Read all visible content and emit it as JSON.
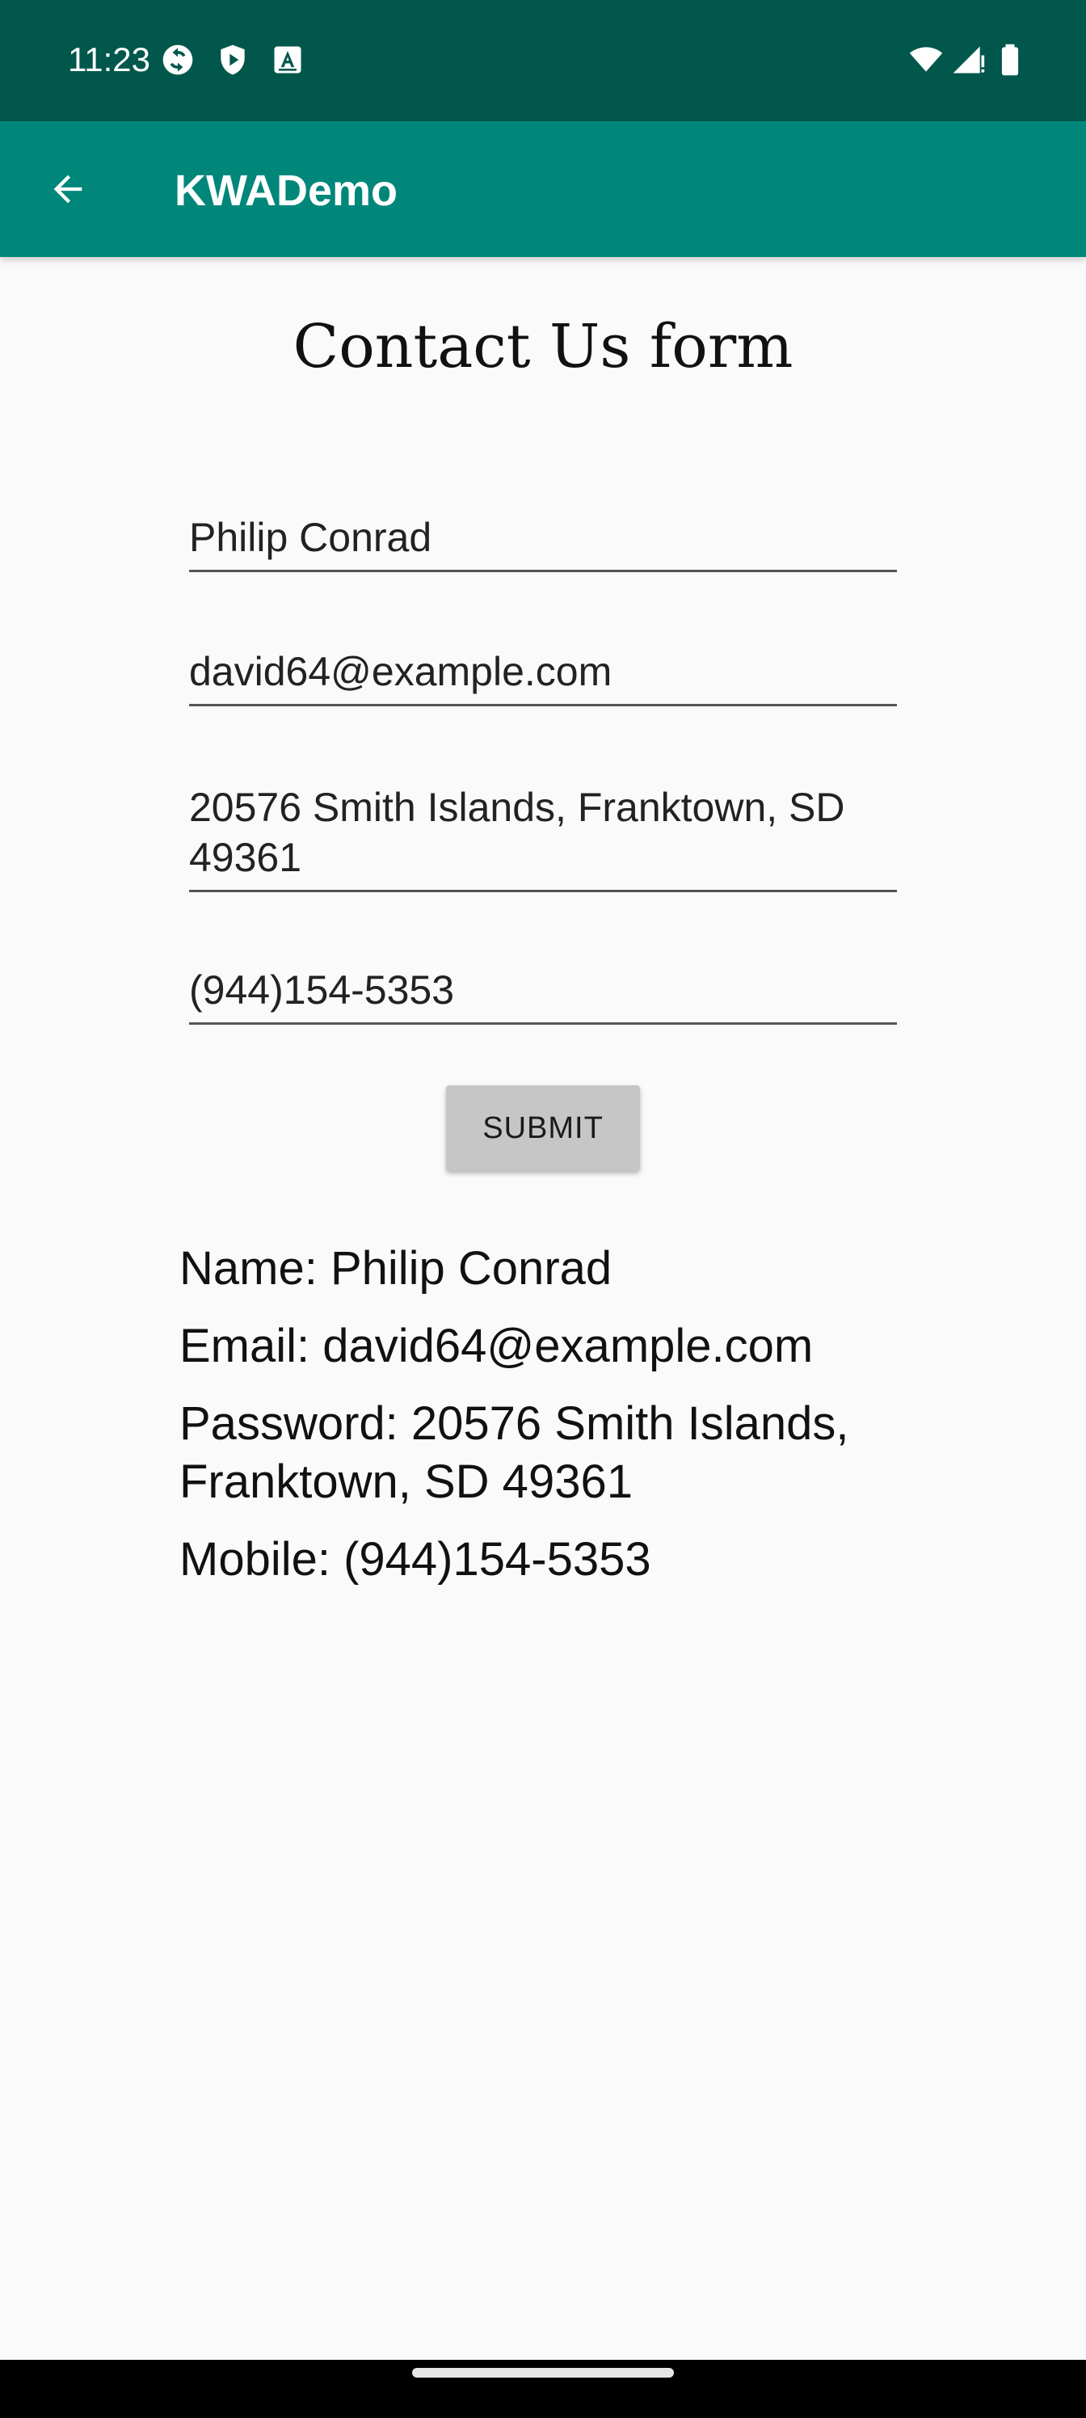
{
  "status_bar": {
    "time": "11:23",
    "background_color": "#01574b",
    "left_icons": [
      "sync-icon",
      "shield-icon",
      "font-a-icon"
    ],
    "right_icons": [
      "wifi-icon",
      "signal-icon",
      "battery-icon"
    ]
  },
  "app_bar": {
    "title": "KWADemo",
    "background_color": "#00877a",
    "back_icon": "arrow-back-icon"
  },
  "form": {
    "title": "Contact Us form",
    "fields": {
      "name": "Philip Conrad",
      "email": "david64@example.com",
      "address": "20576 Smith Islands, Franktown, SD 49361",
      "mobile": "(944)154-5353"
    },
    "submit_label": "SUBMIT"
  },
  "output": {
    "name": "Name: Philip Conrad",
    "email": "Email: david64@example.com",
    "password": "Password: 20576 Smith Islands, Franktown, SD 49361",
    "mobile": "Mobile: (944)154-5353"
  }
}
